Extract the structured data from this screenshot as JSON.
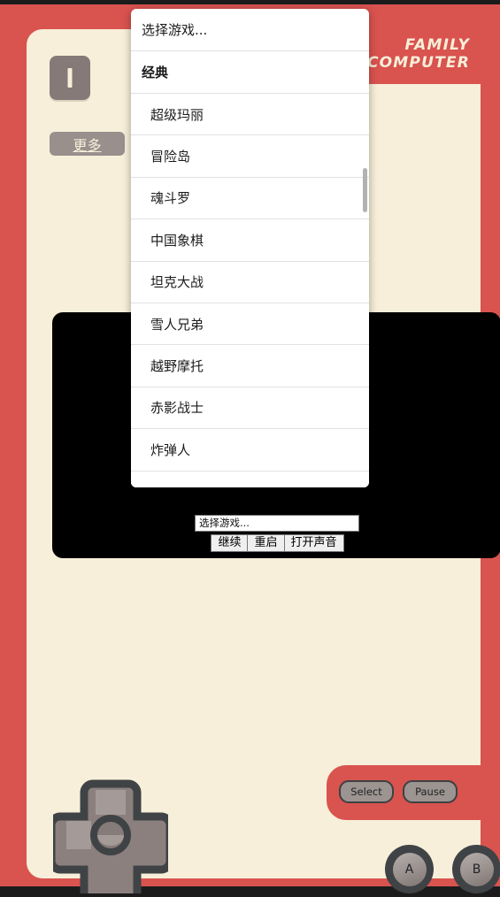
{
  "console": {
    "logo_line1": "FAMILY",
    "logo_line2": "COMPUTER",
    "player_badge": "I",
    "more_label": "更多",
    "shell_red": "#d9534f",
    "body_cream": "#f7efd9",
    "screen_black": "#000000",
    "button_grey": "#99908d"
  },
  "dropdown": {
    "open": true,
    "placeholder_item": "选择游戏...",
    "group_label": "经典",
    "games": [
      "超级玛丽",
      "冒险岛",
      "魂斗罗",
      "中国象棋",
      "坦克大战",
      "雪人兄弟",
      "越野摩托",
      "赤影战士",
      "炸弹人"
    ]
  },
  "emulator": {
    "select_value": "选择游戏...",
    "buttons": [
      "继续",
      "重启",
      "打开声音"
    ]
  },
  "gamepad": {
    "select_label": "Select",
    "pause_label": "Pause",
    "a_label": "A",
    "b_label": "B",
    "dpad": "dpad-cross"
  }
}
